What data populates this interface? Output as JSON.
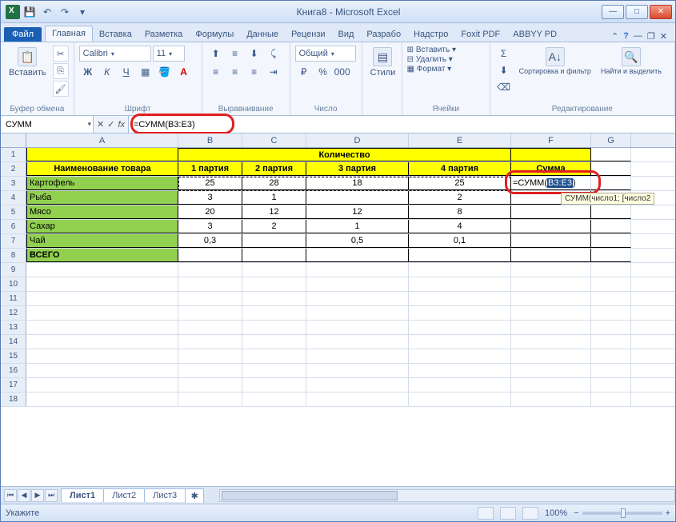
{
  "title": "Книга8 - Microsoft Excel",
  "qat": {
    "save": "💾",
    "undo": "↶",
    "redo": "↷",
    "dd": "▾"
  },
  "tabs": {
    "file": "Файл",
    "items": [
      "Главная",
      "Вставка",
      "Разметка",
      "Формулы",
      "Данные",
      "Рецензи",
      "Вид",
      "Разрабо",
      "Надстро",
      "Foxit PDF",
      "ABBYY PD"
    ],
    "active": 0
  },
  "ribbon": {
    "clipboard": {
      "label": "Буфер обмена",
      "paste": "Вставить",
      "cut": "✂",
      "copy": "⎘",
      "brush": "🖌"
    },
    "font": {
      "label": "Шрифт",
      "name": "Calibri",
      "size": "11"
    },
    "align": {
      "label": "Выравнивание"
    },
    "number": {
      "label": "Число",
      "format": "Общий"
    },
    "styles": {
      "label": "",
      "btn": "Стили"
    },
    "cells": {
      "label": "Ячейки",
      "insert": "Вставить",
      "delete": "Удалить",
      "format": "Формат"
    },
    "editing": {
      "label": "Редактирование",
      "sort": "Сортировка и фильтр",
      "find": "Найти и выделить"
    }
  },
  "formula": {
    "namebox": "СУММ",
    "fx": "fx",
    "value": "=СУММ(B3:E3)"
  },
  "columns": [
    "A",
    "B",
    "C",
    "D",
    "E",
    "F",
    "G"
  ],
  "table": {
    "qty_header": "Количество",
    "name_header": "Наименование товара",
    "cols": [
      "1 партия",
      "2 партия",
      "3 партия",
      "4 партия",
      "Сумма"
    ],
    "rows": [
      {
        "name": "Картофель",
        "v": [
          "25",
          "28",
          "18",
          "25"
        ]
      },
      {
        "name": "Рыба",
        "v": [
          "3",
          "1",
          "",
          "2"
        ]
      },
      {
        "name": "Мясо",
        "v": [
          "20",
          "12",
          "12",
          "8"
        ]
      },
      {
        "name": "Сахар",
        "v": [
          "3",
          "2",
          "1",
          "4"
        ]
      },
      {
        "name": "Чай",
        "v": [
          "0,3",
          "",
          "0,5",
          "0,1"
        ]
      }
    ],
    "total": "ВСЕГО"
  },
  "f3": {
    "prefix": "=СУММ(",
    "range": "B3:E3",
    "suffix": ")"
  },
  "tooltip": "СУММ(число1; [число2",
  "sheets": {
    "items": [
      "Лист1",
      "Лист2",
      "Лист3"
    ],
    "active": 0
  },
  "status": {
    "mode": "Укажите",
    "zoom": "100%",
    "minus": "−",
    "plus": "+"
  },
  "winbtns": {
    "min": "—",
    "max": "□",
    "close": "✕"
  },
  "innerwin": {
    "min": "—",
    "max": "❐",
    "close": "✕"
  }
}
